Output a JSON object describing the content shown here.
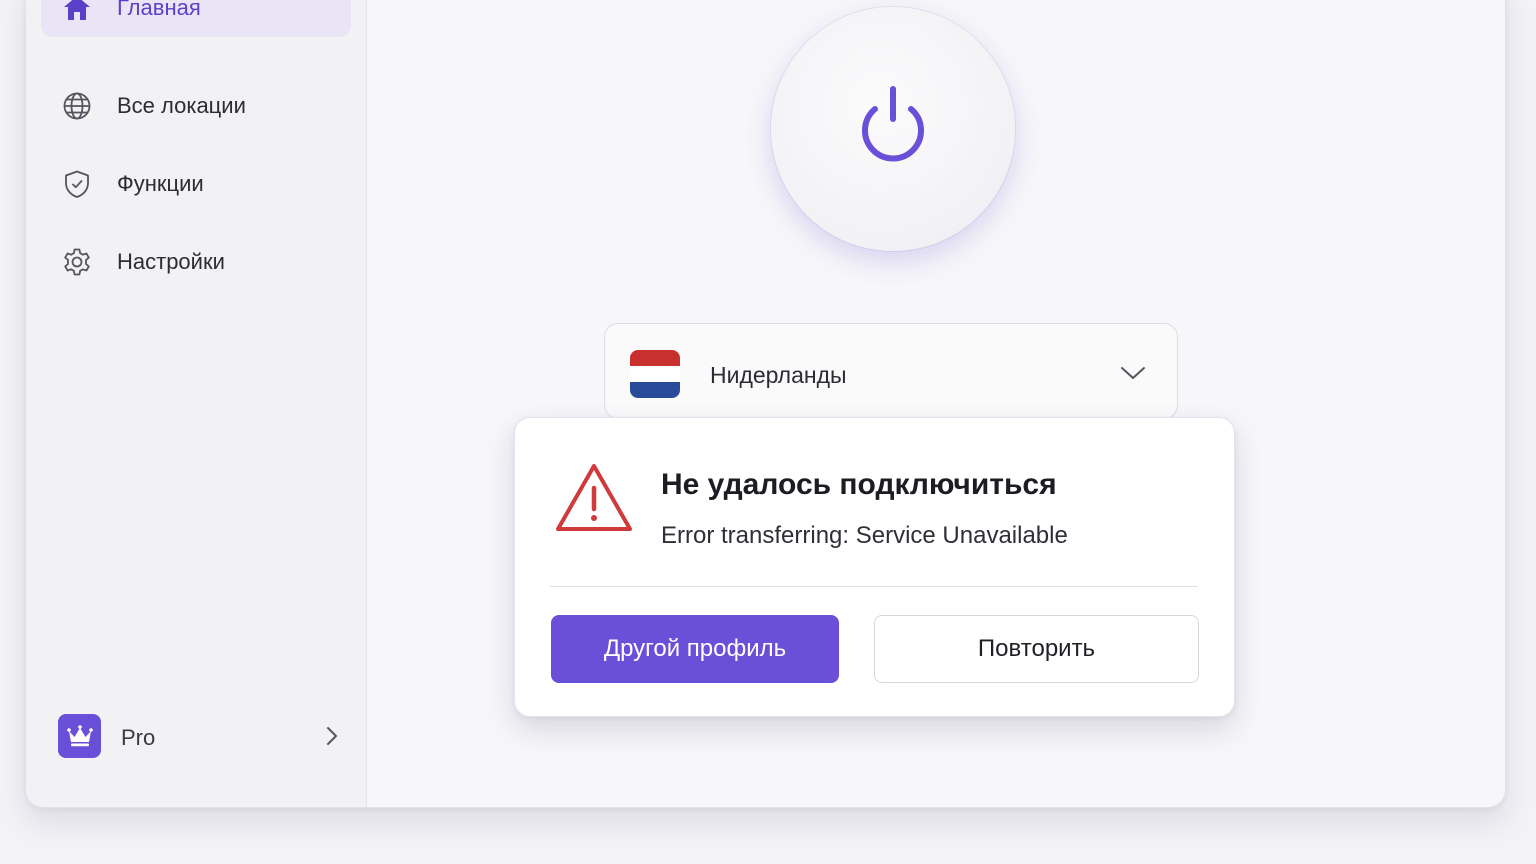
{
  "sidebar": {
    "items": [
      {
        "label": "Главная",
        "icon": "home-icon",
        "active": true
      },
      {
        "label": "Все локации",
        "icon": "globe-icon",
        "active": false
      },
      {
        "label": "Функции",
        "icon": "shield-icon",
        "active": false
      },
      {
        "label": "Настройки",
        "icon": "gear-icon",
        "active": false
      }
    ],
    "pro": {
      "label": "Pro",
      "icon": "crown-icon"
    }
  },
  "main": {
    "power_button": {
      "icon": "power-icon"
    },
    "location": {
      "name": "Нидерланды",
      "flag": "netherlands-flag-icon",
      "flag_colors": [
        "#c8302f",
        "#ffffff",
        "#2a4a9a"
      ]
    }
  },
  "dialog": {
    "title": "Не удалось подключиться",
    "message": "Error transferring: Service Unavailable",
    "icon": "warning-icon",
    "primary_button": "Другой профиль",
    "secondary_button": "Повторить"
  },
  "colors": {
    "accent": "#6a4fd9",
    "accent_text": "#5b40c9",
    "warning": "#d03a3a",
    "active_bg": "#e9e5f6"
  }
}
